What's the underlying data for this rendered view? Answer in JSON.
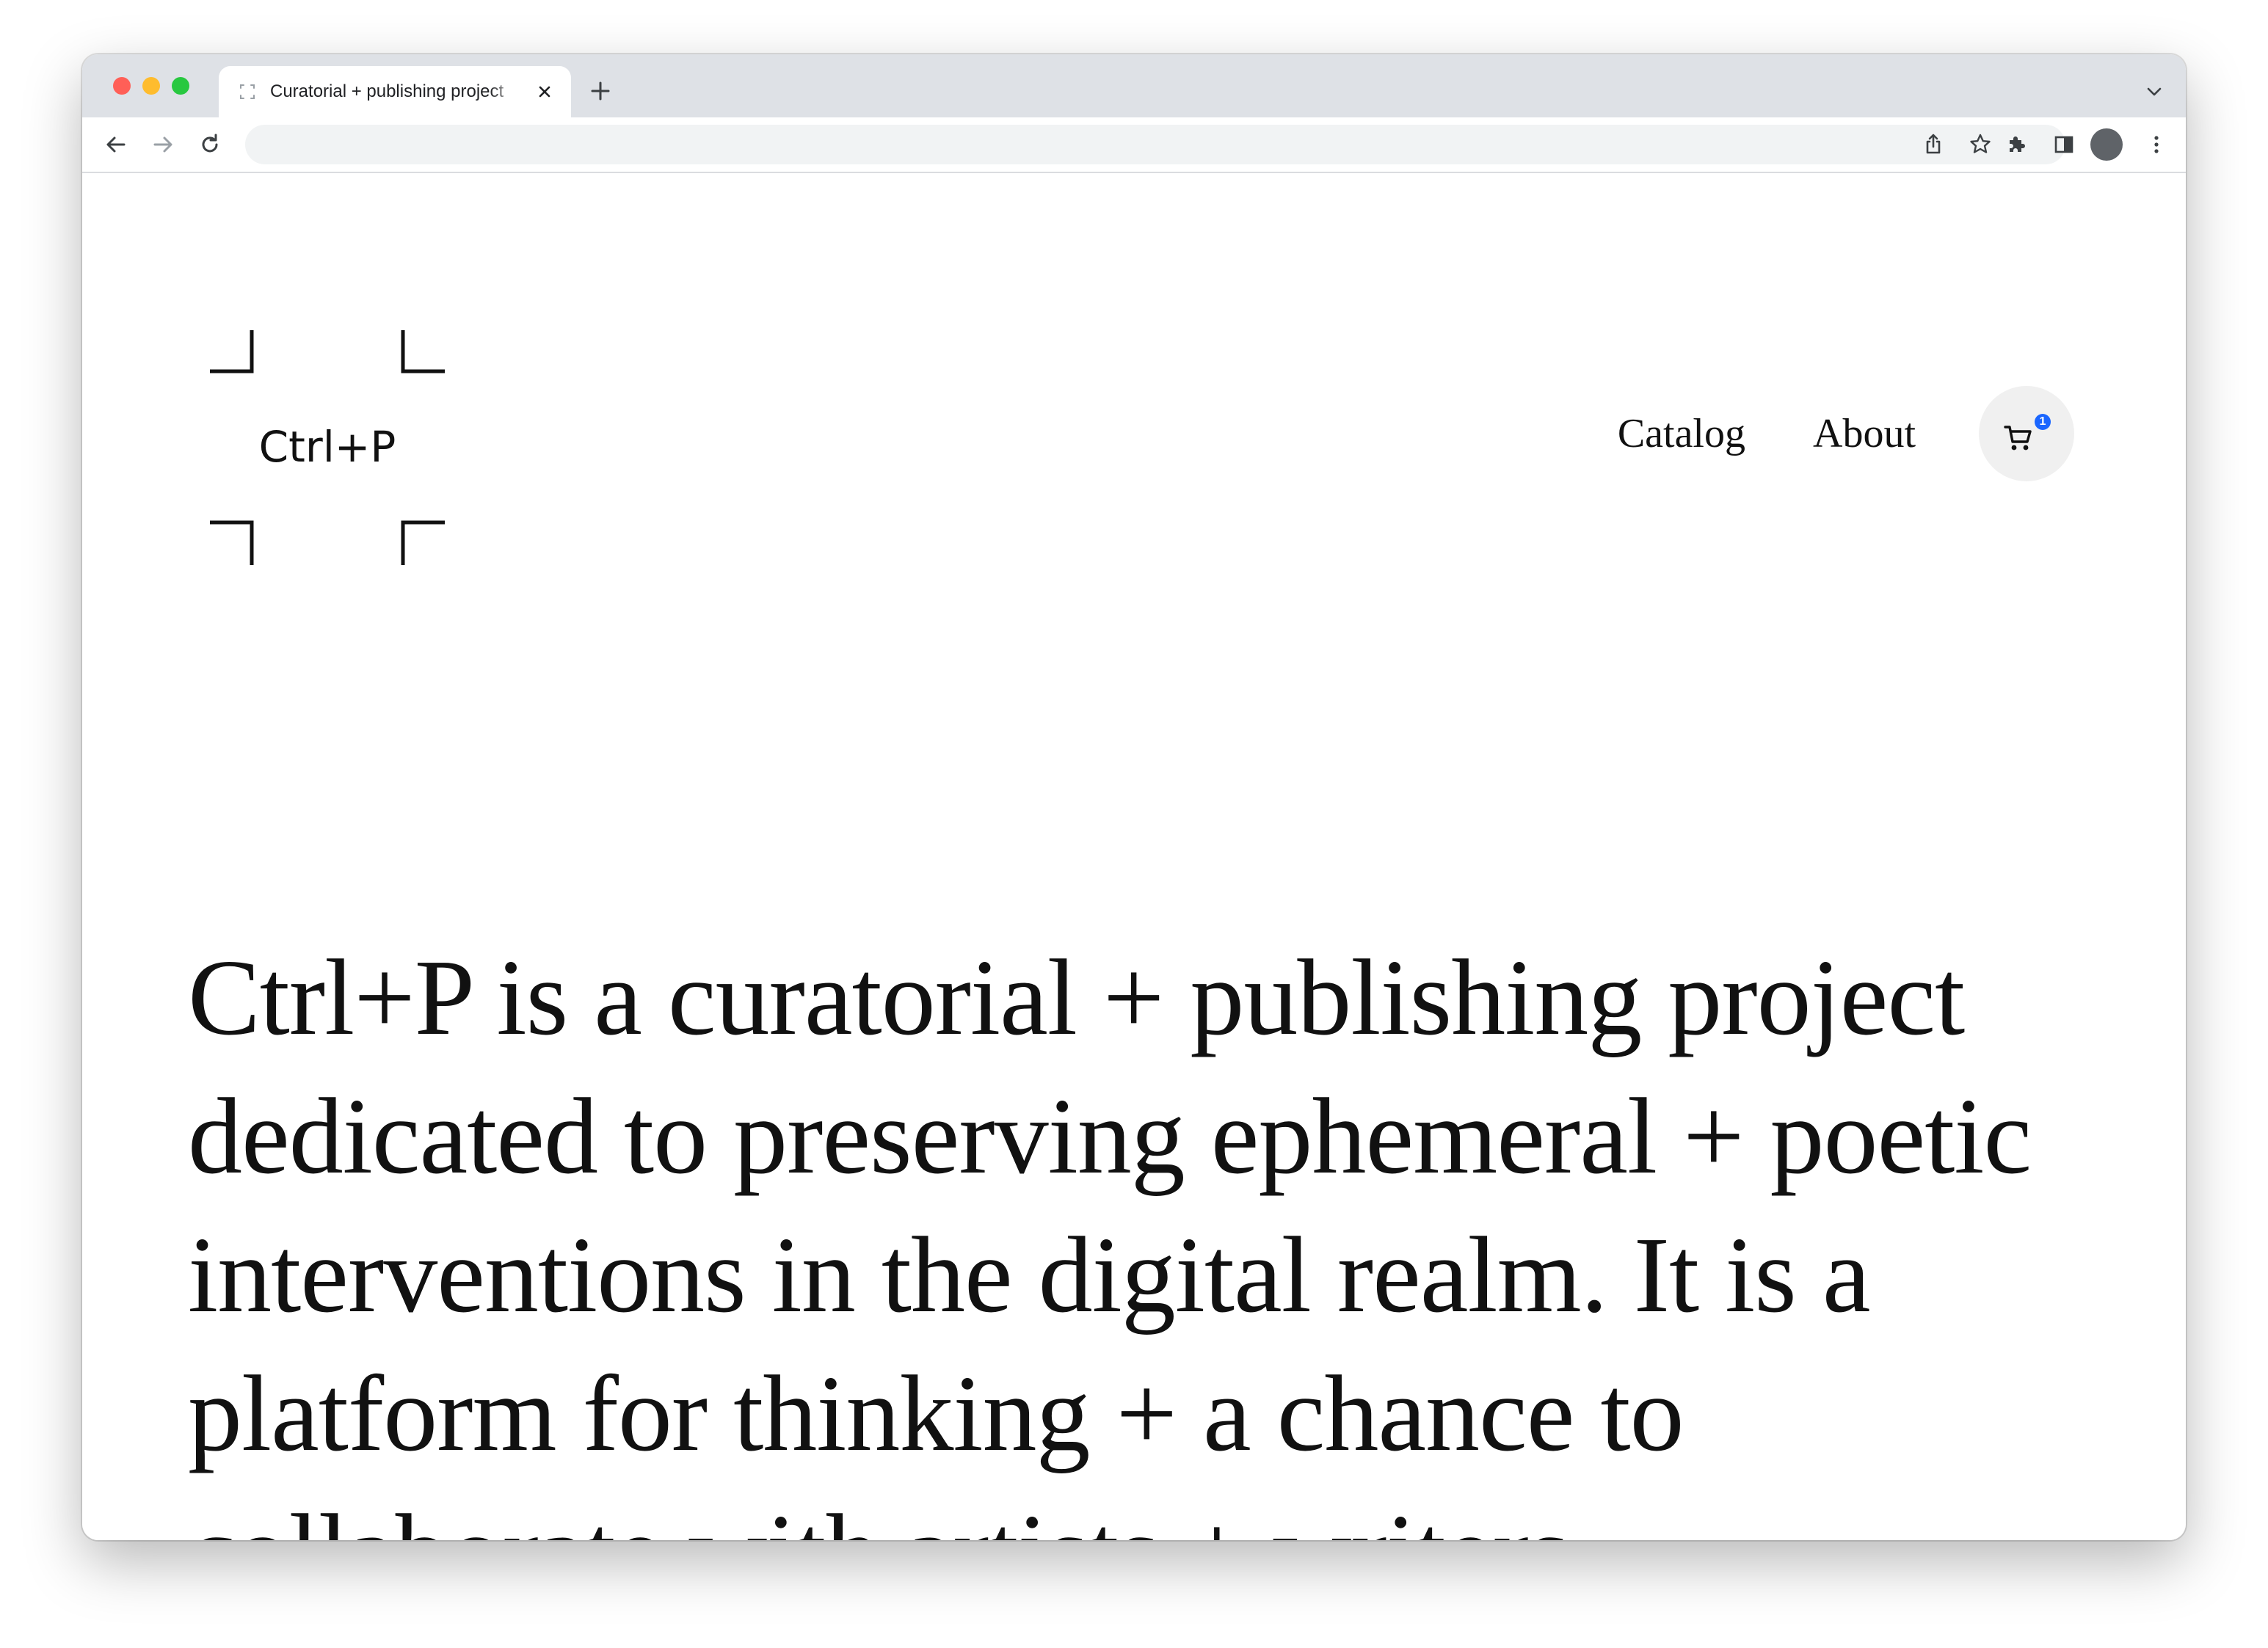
{
  "browser": {
    "tab": {
      "title": "Curatorial + publishing project"
    },
    "omnibox": {
      "value": ""
    }
  },
  "site": {
    "logo_text": "Ctrl+P",
    "nav": {
      "catalog": "Catalog",
      "about": "About"
    },
    "cart": {
      "count": "1",
      "badge_color": "#1a66ff"
    },
    "intro": "Ctrl+P is a curatorial + publishing project dedicated to preserving ephemeral + poetic interventions in the digital realm. It is a platform for thinking + a chance to collaborate with artists + writers."
  },
  "icons": {
    "tab_favicon": "loading-favicon-icon",
    "tab_close": "close-icon",
    "new_tab": "plus-icon",
    "tab_search": "chevron-down-icon",
    "back": "arrow-left-icon",
    "forward": "arrow-right-icon",
    "reload": "reload-icon",
    "share": "share-icon",
    "bookmark": "star-icon",
    "extensions": "puzzle-icon",
    "side_panel": "side-panel-icon",
    "profile": "avatar",
    "menu": "kebab-menu-icon",
    "cart": "cart-icon"
  }
}
